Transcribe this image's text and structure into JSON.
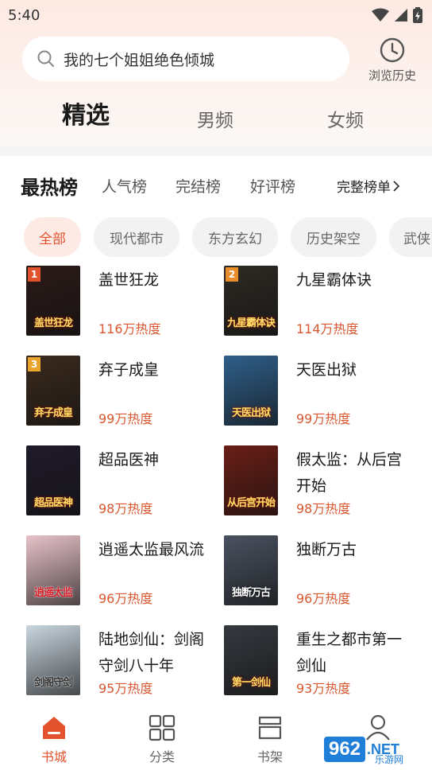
{
  "status": {
    "time": "5:40"
  },
  "search": {
    "query": "我的七个姐姐绝色倾城",
    "history_label": "浏览历史"
  },
  "main_tabs": [
    {
      "label": "精选",
      "active": true
    },
    {
      "label": "男频",
      "active": false
    },
    {
      "label": "女频",
      "active": false
    }
  ],
  "rank": {
    "title": "最热榜",
    "tabs": [
      "人气榜",
      "完结榜",
      "好评榜"
    ],
    "full_label": "完整榜单"
  },
  "categories": [
    "全部",
    "现代都市",
    "东方玄幻",
    "历史架空",
    "武侠"
  ],
  "books": [
    {
      "rank": "1",
      "title": "盖世狂龙",
      "heat": "116万热度",
      "cover_text": "盖世狂龙",
      "cover_color": "#2b1a18"
    },
    {
      "rank": "2",
      "title": "九星霸体诀",
      "heat": "114万热度",
      "cover_text": "九星霸体诀",
      "cover_color": "#2e2a24"
    },
    {
      "rank": "3",
      "title": "弃子成皇",
      "heat": "99万热度",
      "cover_text": "弃子成皇",
      "cover_color": "#3b2a1e"
    },
    {
      "rank": "",
      "title": "天医出狱",
      "heat": "99万热度",
      "cover_text": "天医出狱",
      "cover_color": "#2f5f8a"
    },
    {
      "rank": "",
      "title": "超品医神",
      "heat": "98万热度",
      "cover_text": "超品医神",
      "cover_color": "#1f1a2a"
    },
    {
      "rank": "",
      "title": "假太监：从后宫开始",
      "heat": "98万热度",
      "cover_text": "从后宫开始",
      "cover_color": "#6a1e16"
    },
    {
      "rank": "",
      "title": "逍遥太监最风流",
      "heat": "96万热度",
      "cover_text": "逍遥太监",
      "cover_color": "#e8c3c9"
    },
    {
      "rank": "",
      "title": "独断万古",
      "heat": "96万热度",
      "cover_text": "独断万古",
      "cover_color": "#4a5260"
    },
    {
      "rank": "",
      "title": "陆地剑仙：剑阁守剑八十年",
      "heat": "95万热度",
      "cover_text": "剑阁守剑",
      "cover_color": "#c9d6df"
    },
    {
      "rank": "",
      "title": "重生之都市第一剑仙",
      "heat": "93万热度",
      "cover_text": "第一剑仙",
      "cover_color": "#35393f"
    }
  ],
  "bottom_nav": [
    {
      "label": "书城",
      "icon": "home-icon",
      "active": true
    },
    {
      "label": "分类",
      "icon": "grid-icon",
      "active": false
    },
    {
      "label": "书架",
      "icon": "bookshelf-icon",
      "active": false
    },
    {
      "label": "",
      "icon": "profile-icon",
      "active": false
    }
  ],
  "watermark": {
    "box": "962",
    "net": ".NET",
    "sub": "乐游网"
  },
  "colors": {
    "accent": "#e2532d",
    "heat": "#d9572f"
  }
}
